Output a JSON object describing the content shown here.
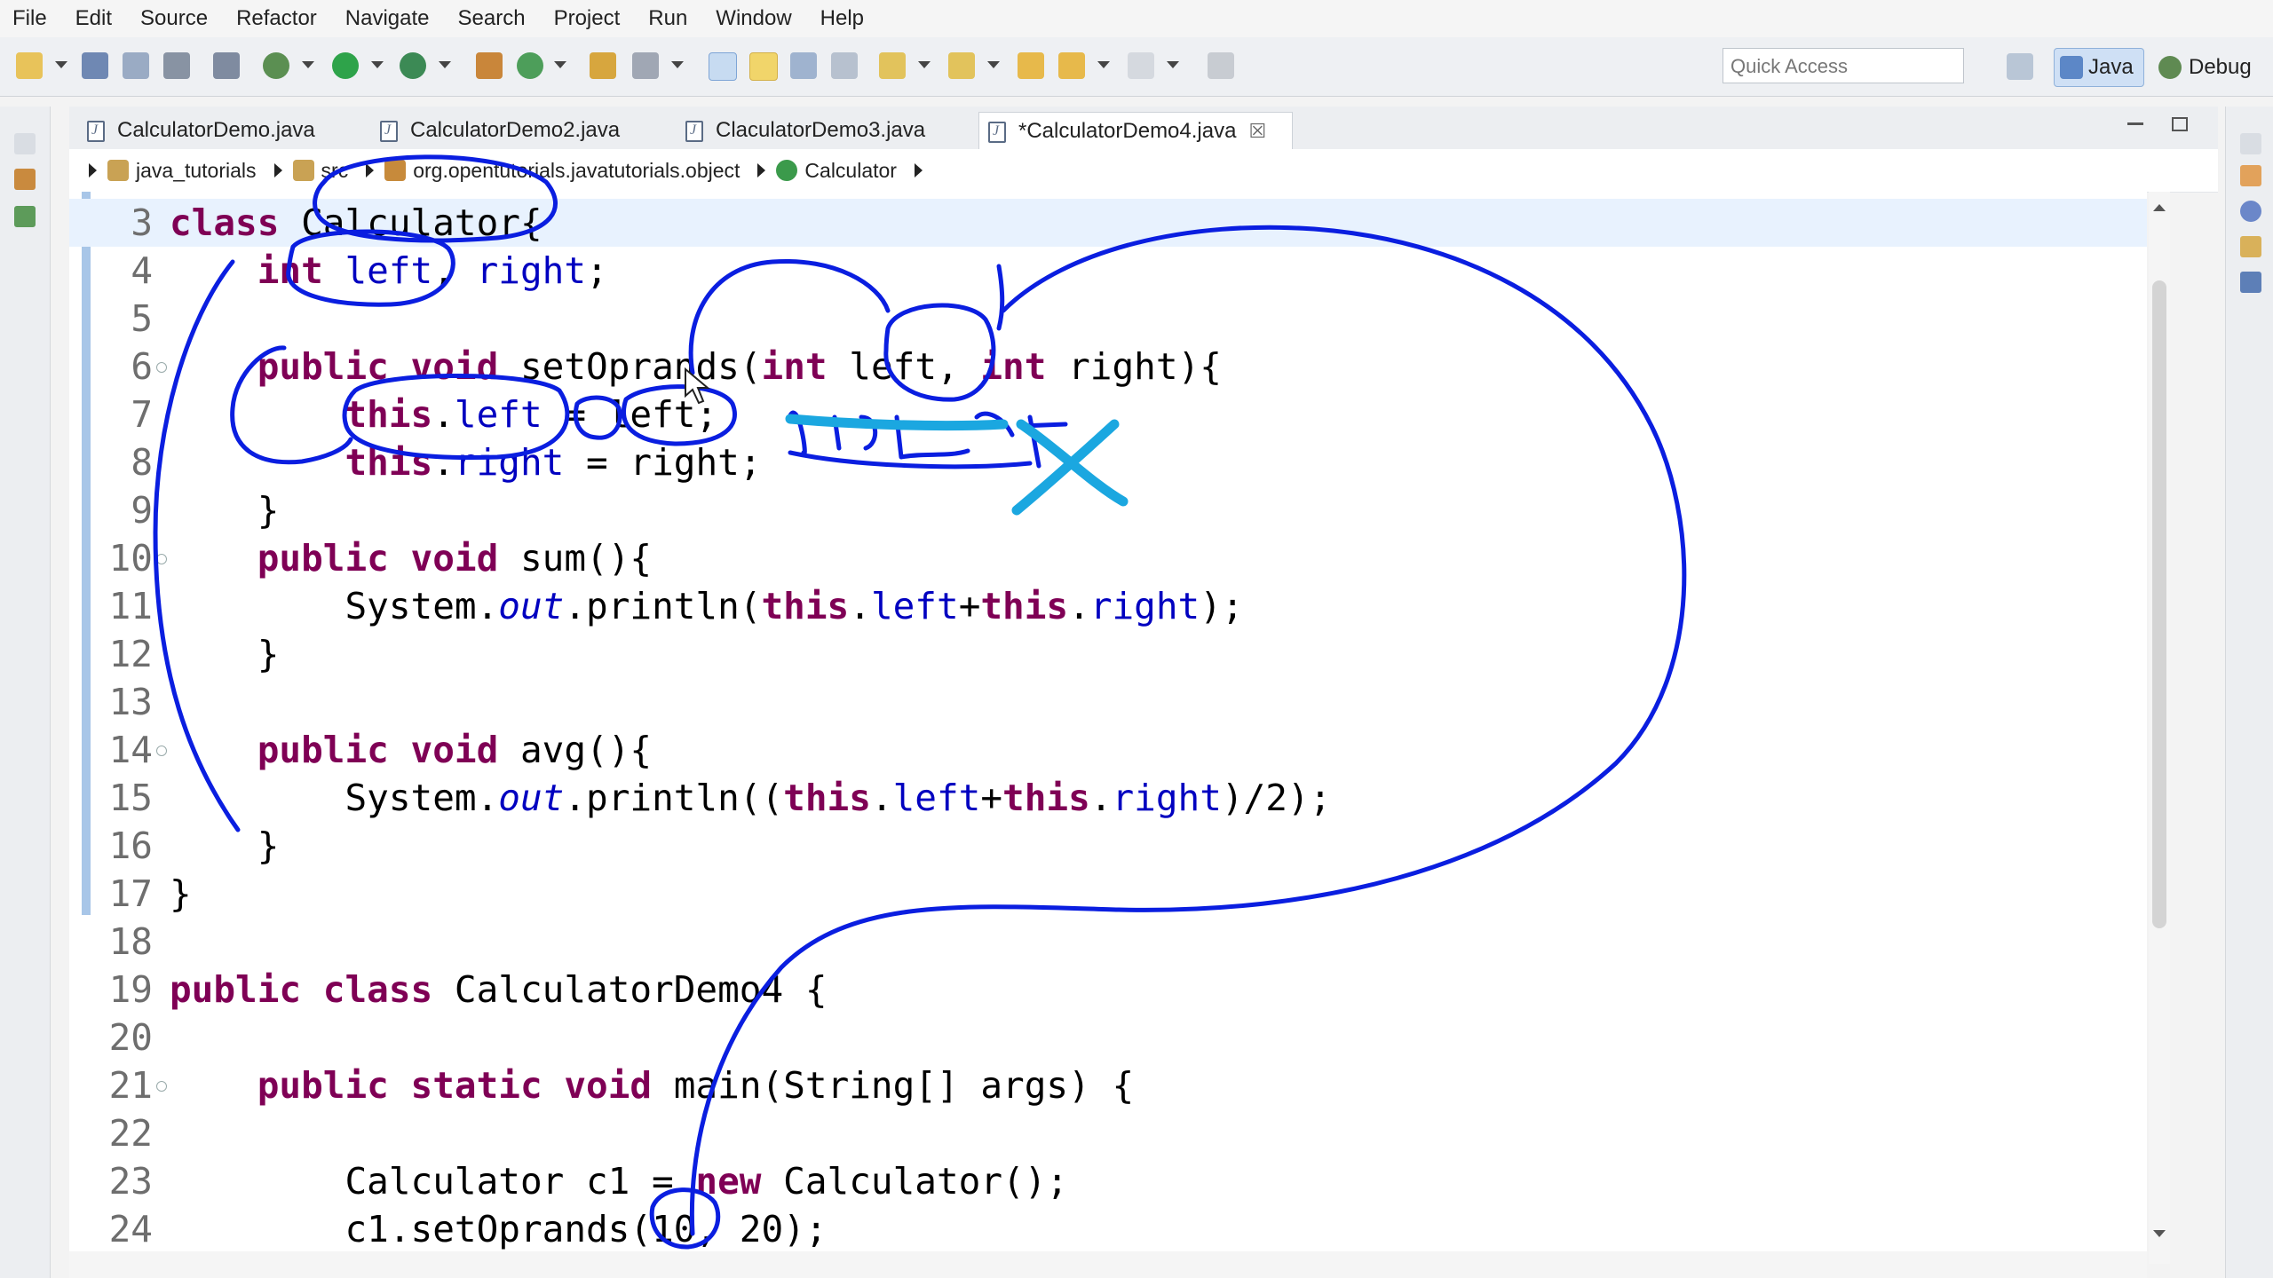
{
  "menu": [
    "File",
    "Edit",
    "Source",
    "Refactor",
    "Navigate",
    "Search",
    "Project",
    "Run",
    "Window",
    "Help"
  ],
  "toolbar": {
    "quick_access_placeholder": "Quick Access",
    "perspective_java": "Java",
    "perspective_debug": "Debug"
  },
  "tabs": [
    {
      "label": "CalculatorDemo.java"
    },
    {
      "label": "CalculatorDemo2.java"
    },
    {
      "label": "ClaculatorDemo3.java"
    },
    {
      "label": "*CalculatorDemo4.java",
      "close": "☒"
    }
  ],
  "breadcrumb": [
    "java_tutorials",
    "src",
    "org.opentutorials.javatutorials.object",
    "Calculator"
  ],
  "editor": {
    "lines": [
      {
        "n": "3",
        "html": "<span class='k'>class</span> Calculator{"
      },
      {
        "n": "4",
        "html": "    <span class='k'>int</span> <span class='f'>left</span>, <span class='f'>right</span>;"
      },
      {
        "n": "5",
        "html": ""
      },
      {
        "n": "6",
        "html": "    <span class='k'>public</span> <span class='k'>void</span> setOprands(<span class='k'>int</span> left, <span class='k'>int</span> right){",
        "fold": true
      },
      {
        "n": "7",
        "html": "        <span class='k'>this</span>.<span class='f'>left</span> = left;"
      },
      {
        "n": "8",
        "html": "        <span class='k'>this</span>.<span class='f'>right</span> = right;"
      },
      {
        "n": "9",
        "html": "    }"
      },
      {
        "n": "10",
        "html": "    <span class='k'>public</span> <span class='k'>void</span> sum(){",
        "fold": true
      },
      {
        "n": "11",
        "html": "        System.<span class='fi'>out</span>.println(<span class='k'>this</span>.<span class='f'>left</span>+<span class='k'>this</span>.<span class='f'>right</span>);"
      },
      {
        "n": "12",
        "html": "    }"
      },
      {
        "n": "13",
        "html": ""
      },
      {
        "n": "14",
        "html": "    <span class='k'>public</span> <span class='k'>void</span> avg(){",
        "fold": true
      },
      {
        "n": "15",
        "html": "        System.<span class='fi'>out</span>.println((<span class='k'>this</span>.<span class='f'>left</span>+<span class='k'>this</span>.<span class='f'>right</span>)/2);"
      },
      {
        "n": "16",
        "html": "    }"
      },
      {
        "n": "17",
        "html": "}"
      },
      {
        "n": "18",
        "html": ""
      },
      {
        "n": "19",
        "html": "<span class='k'>public</span> <span class='k'>class</span> CalculatorDemo4 {"
      },
      {
        "n": "20",
        "html": ""
      },
      {
        "n": "21",
        "html": "    <span class='k'>public</span> <span class='k'>static</span> <span class='k'>void</span> main(String[] args) {",
        "fold": true
      },
      {
        "n": "22",
        "html": ""
      },
      {
        "n": "23",
        "html": "        Calculator c1 = <span class='k'>new</span> Calculator();"
      },
      {
        "n": "24",
        "html": "        c1.setOprands(10, 20);"
      }
    ]
  },
  "colors": {
    "keyword": "#7f0055",
    "field": "#0000c0",
    "annotation_blue": "#0a1ee0",
    "annotation_cyan": "#1ba7e0"
  },
  "icons": [
    "new-icon",
    "save-icon",
    "print-icon",
    "debug-icon",
    "run-icon",
    "java-perspective-icon",
    "debug-perspective-icon",
    "java-file-icon",
    "package-icon",
    "class-icon"
  ]
}
